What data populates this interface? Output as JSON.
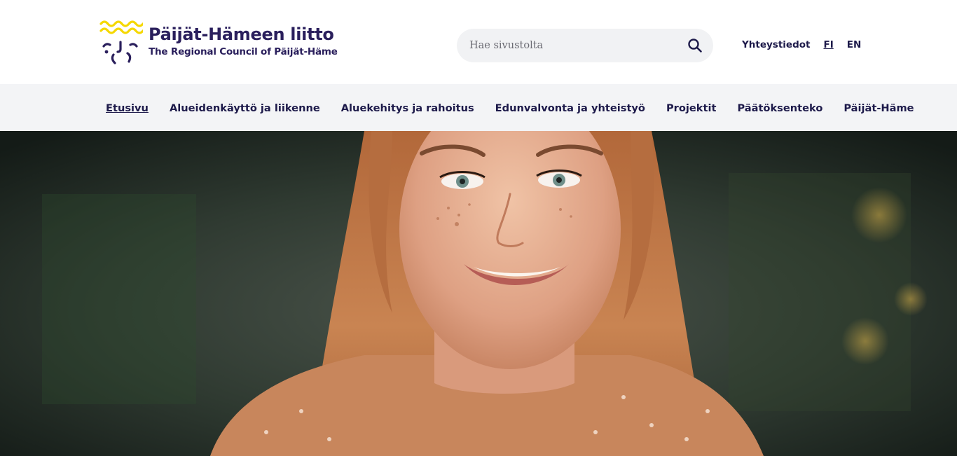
{
  "header": {
    "logo": {
      "title": "Päijät-Hämeen liitto",
      "subtitle": "The Regional Council of Päijät-Häme",
      "icon": "regional-emblem-icon",
      "accent_color": "#f5d800"
    },
    "search": {
      "placeholder": "Hae sivustolta",
      "value": "",
      "icon": "search-icon"
    },
    "links": {
      "contact": "Yhteystiedot",
      "lang_fi": "FI",
      "lang_en": "EN"
    }
  },
  "nav": {
    "items": [
      {
        "label": "Etusivu",
        "active": true
      },
      {
        "label": "Alueidenkäyttö ja liikenne",
        "active": false
      },
      {
        "label": "Aluekehitys ja rahoitus",
        "active": false
      },
      {
        "label": "Edunvalvonta ja yhteistyö",
        "active": false
      },
      {
        "label": "Projektit",
        "active": false
      },
      {
        "label": "Päätöksenteko",
        "active": false
      },
      {
        "label": "Päijät-Häme",
        "active": false
      }
    ]
  },
  "hero": {
    "image": "smiling-young-woman-portrait"
  },
  "colors": {
    "brand_dark": "#2a1f5c",
    "nav_bg": "#f3f4f6",
    "search_bg": "#f1f2f4",
    "logo_yellow": "#f5d800"
  }
}
